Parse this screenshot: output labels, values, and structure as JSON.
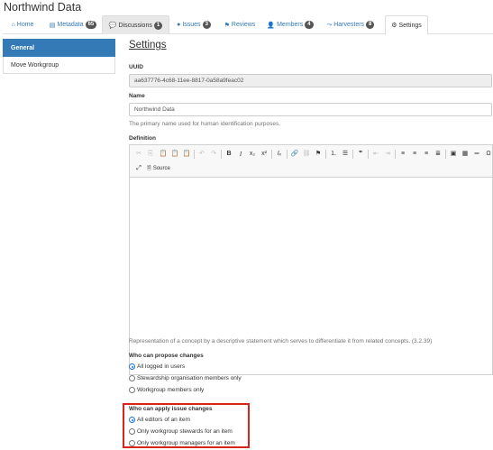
{
  "page": {
    "title": "Northwind Data"
  },
  "tabs": [
    {
      "label": "Home",
      "icon": "home-icon",
      "badge": ""
    },
    {
      "label": "Metadata",
      "icon": "file-icon",
      "badge": "65"
    },
    {
      "label": "Discussions",
      "icon": "comments-icon",
      "badge": "1"
    },
    {
      "label": "Issues",
      "icon": "exclamation-icon",
      "badge": "3"
    },
    {
      "label": "Reviews",
      "icon": "flag-icon",
      "badge": ""
    },
    {
      "label": "Members",
      "icon": "user-icon",
      "badge": "4"
    },
    {
      "label": "Harvesters",
      "icon": "harvester-icon",
      "badge": "8"
    },
    {
      "label": "Settings",
      "icon": "cogs-icon",
      "badge": ""
    }
  ],
  "sidebar": {
    "items": [
      {
        "label": "General"
      },
      {
        "label": "Move Workgroup"
      }
    ]
  },
  "settings": {
    "heading": "Settings",
    "uuid_label": "UUID",
    "uuid_value": "aa637776-4c68-11ee-8817-0a58a9feac02",
    "name_label": "Name",
    "name_value": "Northwind Data",
    "name_help": "The primary name used for human identification purposes.",
    "definition_label": "Definition",
    "source_label": "Source",
    "definition_help": "Representation of a concept by a descriptive statement which serves to differentiate it from related concepts. (3.2.39)",
    "propose_label": "Who can propose changes",
    "propose_options": [
      {
        "label": "All logged in users",
        "selected": true
      },
      {
        "label": "Stewardship organisation members only",
        "selected": false
      },
      {
        "label": "Workgroup members only",
        "selected": false
      }
    ],
    "issue_label": "Who can apply issue changes",
    "issue_options": [
      {
        "label": "All editors of an item",
        "selected": true
      },
      {
        "label": "Only workgroup stewards for an item",
        "selected": false
      },
      {
        "label": "Only workgroup managers for an item",
        "selected": false
      }
    ]
  },
  "colors": {
    "accent": "#337ab7",
    "highlight": "#d9231b",
    "radio": "#1a73e8"
  }
}
